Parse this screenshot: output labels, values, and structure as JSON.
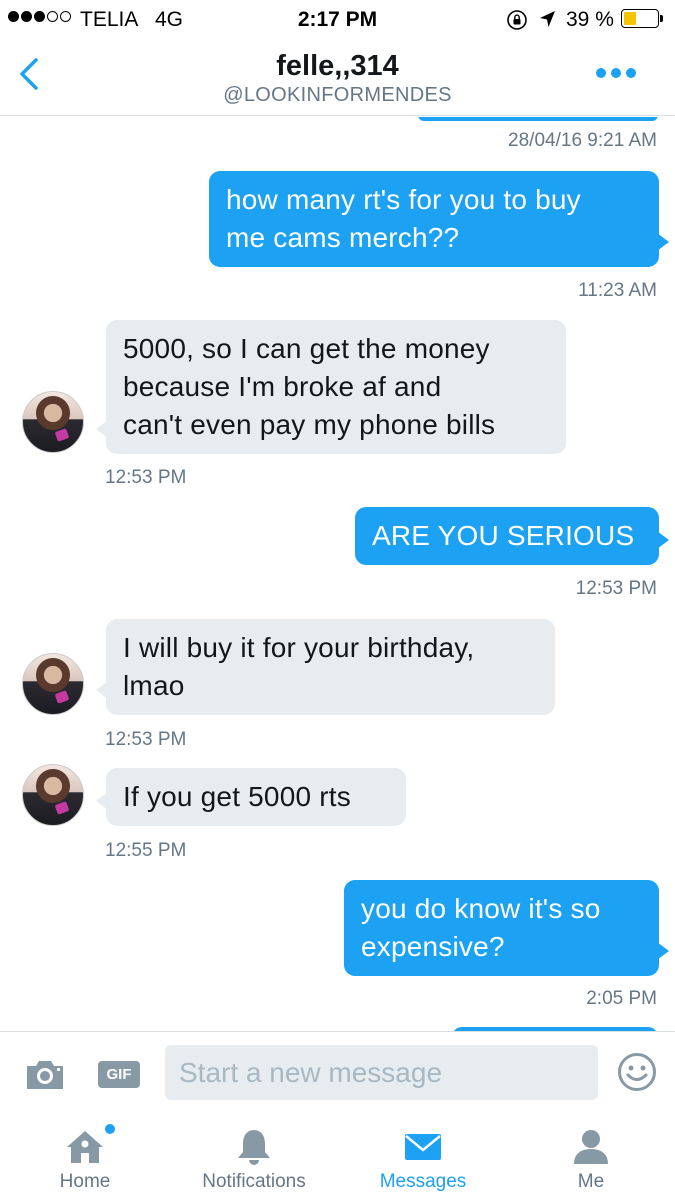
{
  "status_bar": {
    "carrier": "TELIA",
    "network": "4G",
    "time": "2:17 PM",
    "battery_percent": "39 %",
    "battery_level": 0.39,
    "signal_bars_filled": 3,
    "signal_bars_total": 5
  },
  "header": {
    "title": "felle,,314",
    "handle": "@LOOKINFORMENDES"
  },
  "conversation": {
    "top_timestamp": "28/04/16 9:21 AM",
    "messages": [
      {
        "direction": "sent",
        "text_lines": [
          "how many rt's for you to buy",
          "me cams merch??"
        ],
        "time": "11:23 AM"
      },
      {
        "direction": "received",
        "text_lines": [
          "5000, so I can get the money",
          "because I'm broke af and",
          "can't even pay my phone bills"
        ],
        "time": "12:53 PM"
      },
      {
        "direction": "sent",
        "text_lines": [
          "ARE YOU SERIOUS"
        ],
        "time": "12:53 PM"
      },
      {
        "direction": "received",
        "text_lines": [
          "I will buy it for your birthday,",
          "lmao"
        ],
        "time": "12:53 PM"
      },
      {
        "direction": "received",
        "text_lines": [
          "If you get 5000 rts"
        ],
        "time": "12:55 PM"
      },
      {
        "direction": "sent",
        "text_lines": [
          "you do know it's so",
          "expensive?"
        ],
        "time": "2:05 PM"
      }
    ]
  },
  "composer": {
    "gif_label": "GIF",
    "placeholder": "Start a new message"
  },
  "tab_bar": {
    "tabs": [
      {
        "label": "Home",
        "icon": "home-icon",
        "active": false,
        "has_badge": true
      },
      {
        "label": "Notifications",
        "icon": "bell-icon",
        "active": false,
        "has_badge": false
      },
      {
        "label": "Messages",
        "icon": "envelope-icon",
        "active": true,
        "has_badge": false
      },
      {
        "label": "Me",
        "icon": "person-icon",
        "active": false,
        "has_badge": false
      }
    ]
  },
  "colors": {
    "accent": "#1da1f2",
    "received_bubble": "#e6ecf0",
    "secondary_text": "#657786",
    "battery": "#f5c400"
  }
}
